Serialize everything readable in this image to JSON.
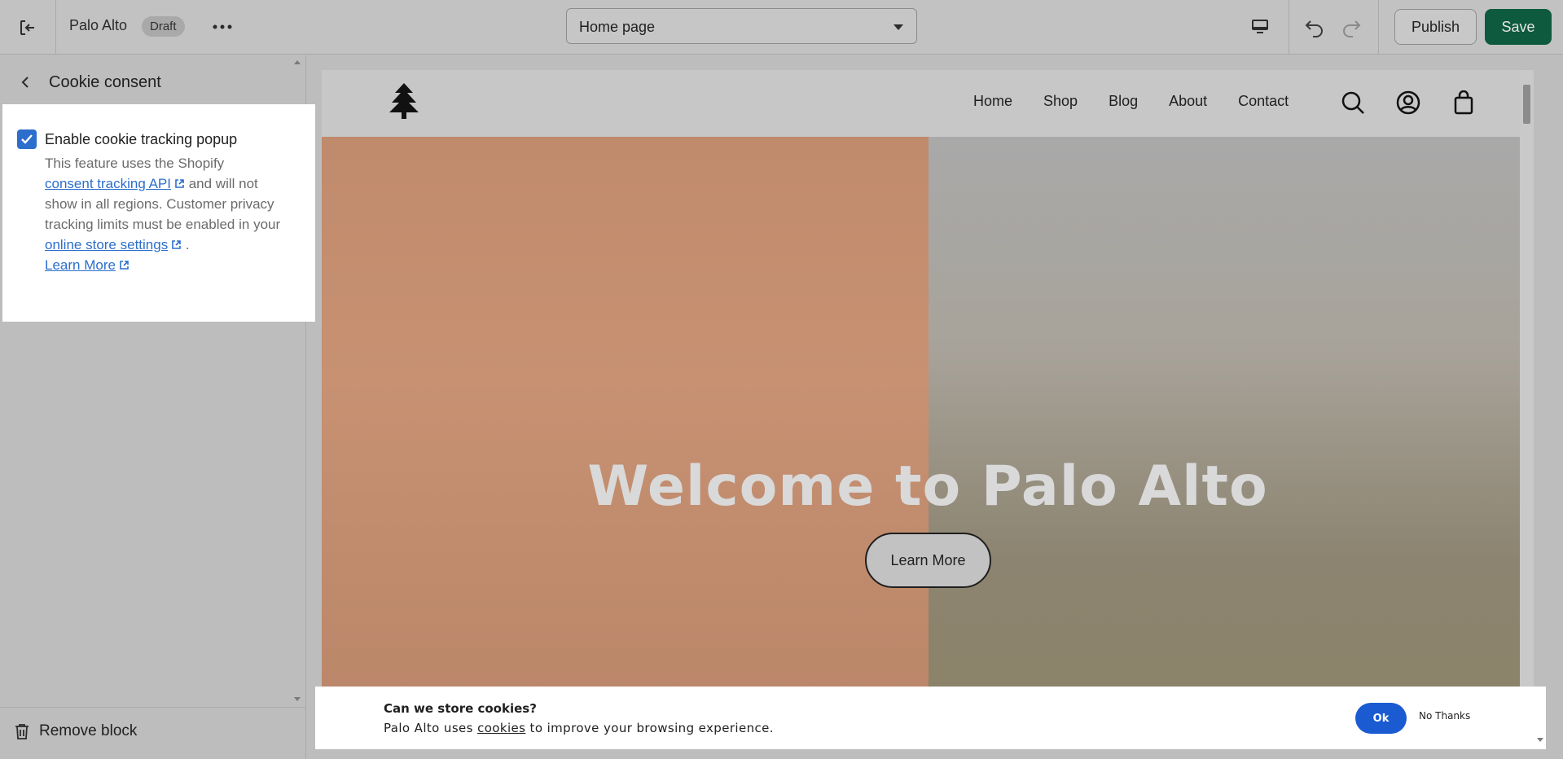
{
  "topbar": {
    "store_name": "Palo Alto",
    "status_badge": "Draft",
    "page_selector": "Home page",
    "publish_label": "Publish",
    "save_label": "Save"
  },
  "sidebar": {
    "title": "Cookie consent",
    "checkbox_label": "Enable cookie tracking popup",
    "checkbox_checked": true,
    "help_text_1": "This feature uses the Shopify",
    "help_link_1": "consent tracking API",
    "help_text_2": " and will not show in all regions. Customer privacy tracking limits must be enabled in your",
    "help_link_2": "online store settings",
    "help_text_3": " .",
    "help_link_3": "Learn More",
    "remove_label": "Remove block"
  },
  "store": {
    "nav": [
      "Home",
      "Shop",
      "Blog",
      "About",
      "Contact"
    ],
    "hero_title": "Welcome to Palo Alto",
    "hero_button": "Learn More"
  },
  "cookie_banner": {
    "title": "Can we store cookies?",
    "text_before": "Palo Alto uses ",
    "link": "cookies",
    "text_after": " to improve your browsing experience.",
    "ok_label": "Ok",
    "no_thanks_label": "No Thanks"
  },
  "colors": {
    "accent_blue": "#2c6ecb",
    "save_green": "#0e5a3f",
    "ok_blue": "#1a5bd2"
  }
}
